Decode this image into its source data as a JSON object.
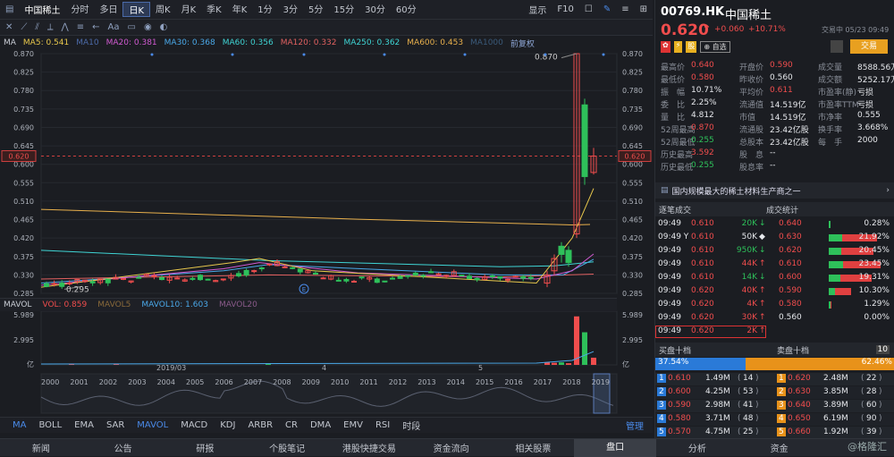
{
  "toolbar": {
    "name": "中国稀土",
    "periods": [
      "分时",
      "多日",
      "日K",
      "周K",
      "月K",
      "季K",
      "年K",
      "1分",
      "3分",
      "5分",
      "15分",
      "30分",
      "60分"
    ],
    "active": "日K",
    "display": "显示",
    "f10": "F10"
  },
  "ma_legend": [
    {
      "t": "MA",
      "c": "#c8ccd4"
    },
    {
      "t": "MA5: 0.541",
      "c": "#e8c84c"
    },
    {
      "t": "MA10",
      "c": "#4c6aa8"
    },
    {
      "t": "MA20: 0.381",
      "c": "#d05ad0"
    },
    {
      "t": "MA30: 0.368",
      "c": "#4aa8e8"
    },
    {
      "t": "MA60: 0.356",
      "c": "#3fd4d4"
    },
    {
      "t": "MA120: 0.332",
      "c": "#e06060"
    },
    {
      "t": "MA250: 0.362",
      "c": "#3fd4d4"
    },
    {
      "t": "MA600: 0.453",
      "c": "#e8b04c"
    },
    {
      "t": "MA1000",
      "c": "#3a5a7a"
    },
    {
      "t": "前复权",
      "c": "#8fa8d8"
    }
  ],
  "price_axis": [
    "0.870",
    "0.825",
    "0.780",
    "0.735",
    "0.690",
    "0.645",
    "0.600",
    "0.555",
    "0.510",
    "0.465",
    "0.420",
    "0.375",
    "0.330",
    "0.285"
  ],
  "price_marker": "0.620",
  "high_label": "0.870",
  "low_label": "0.295",
  "vol_legend": [
    {
      "t": "MAVOL",
      "c": "#c8ccd4"
    },
    {
      "t": "VOL: 0.859",
      "c": "#f04d4d"
    },
    {
      "t": "MAVOL5",
      "c": "#8a6a3a"
    },
    {
      "t": "MAVOL10: 1.603",
      "c": "#4aa8e8"
    },
    {
      "t": "MAVOL20",
      "c": "#8a5a8a"
    }
  ],
  "vol_axis": [
    "5.989",
    "2.995",
    "亿"
  ],
  "date_label": "2019/03",
  "markers": [
    "4",
    "5"
  ],
  "x_years": [
    "2000",
    "2001",
    "2002",
    "2003",
    "2004",
    "2005",
    "2006",
    "2007",
    "2008",
    "2009",
    "2010",
    "2011",
    "2012",
    "2013",
    "2014",
    "2015",
    "2016",
    "2017",
    "2018",
    "2019"
  ],
  "indicators": [
    "MA",
    "BOLL",
    "EMA",
    "SAR",
    "MAVOL",
    "MACD",
    "KDJ",
    "ARBR",
    "CR",
    "DMA",
    "EMV",
    "RSI",
    "时段"
  ],
  "manage": "管理",
  "bottom_tabs": [
    "新闻",
    "公告",
    "研报",
    "个股笔记",
    "港股快捷交易",
    "资金流向",
    "相关股票",
    "盘口",
    "分析",
    "资金"
  ],
  "watermark": "格隆汇",
  "stock": {
    "code": "00769.HK",
    "name": "中国稀土",
    "price": "0.620",
    "arrow": "↑",
    "change": "+0.060",
    "pct": "+10.71%",
    "status": "交易中 05/23 09:49",
    "self": "自选",
    "trade": "交易",
    "intro": "国内规模最大的稀土材料生产商之一"
  },
  "stats": [
    [
      [
        "最高价",
        "0.640",
        "up"
      ],
      [
        "开盘价",
        "0.590",
        "up"
      ],
      [
        "成交量",
        "8588.56万",
        "wh"
      ]
    ],
    [
      [
        "最低价",
        "0.580",
        "up"
      ],
      [
        "昨收价",
        "0.560",
        "wh"
      ],
      [
        "成交额",
        "5252.17万",
        "wh"
      ]
    ],
    [
      [
        "振　幅",
        "10.71%",
        "wh"
      ],
      [
        "平均价",
        "0.611",
        "up"
      ],
      [
        "市盈率(静)",
        "亏损",
        "wh"
      ]
    ],
    [
      [
        "委　比",
        "2.25%",
        "wh"
      ],
      [
        "流通值",
        "14.519亿",
        "wh"
      ],
      [
        "市盈率TTM",
        "亏损",
        "wh"
      ]
    ],
    [
      [
        "量　比",
        "4.812",
        "wh"
      ],
      [
        "市值",
        "14.519亿",
        "wh"
      ],
      [
        "市净率",
        "0.555",
        "wh"
      ]
    ],
    [
      [
        "52周最高",
        "0.870",
        "up"
      ],
      [
        "流通股",
        "23.42亿股",
        "wh"
      ],
      [
        "换手率",
        "3.668%",
        "wh"
      ]
    ],
    [
      [
        "52周最低",
        "0.255",
        "dn"
      ],
      [
        "总股本",
        "23.42亿股",
        "wh"
      ],
      [
        "每　手",
        "2000",
        "wh"
      ]
    ],
    [
      [
        "历史最高",
        "3.592",
        "up"
      ],
      [
        "股　息",
        "--",
        "wh"
      ],
      [
        "",
        "",
        ""
      ]
    ],
    [
      [
        "历史最低",
        "0.255",
        "dn"
      ],
      [
        "股息率",
        "--",
        "wh"
      ],
      [
        "",
        "",
        ""
      ]
    ]
  ],
  "ticks_title": "逐笔成交",
  "stat_title": "成交统计",
  "ticks": [
    [
      "09:49",
      "0.610",
      "20K",
      "↓",
      "dn"
    ],
    [
      "09:49 Y",
      "0.610",
      "50K",
      "◆",
      "wh"
    ],
    [
      "09:49",
      "0.610",
      "950K",
      "↓",
      "dn"
    ],
    [
      "09:49",
      "0.610",
      "44K",
      "↑",
      "up"
    ],
    [
      "09:49",
      "0.610",
      "14K",
      "↓",
      "dn"
    ],
    [
      "09:49",
      "0.620",
      "40K",
      "↑",
      "up"
    ],
    [
      "09:49",
      "0.620",
      "4K",
      "↑",
      "up"
    ],
    [
      "09:49",
      "0.620",
      "30K",
      "↑",
      "up"
    ],
    [
      "09:49",
      "0.620",
      "2K",
      "↑",
      "up"
    ]
  ],
  "dist": [
    [
      "0.640",
      "0.28%",
      1
    ],
    [
      "0.630",
      "21.92%",
      60
    ],
    [
      "0.620",
      "20.45%",
      56
    ],
    [
      "0.610",
      "23.45%",
      64
    ],
    [
      "0.600",
      "19.31%",
      53
    ],
    [
      "0.590",
      "10.30%",
      28
    ],
    [
      "0.580",
      "1.29%",
      3
    ],
    [
      "0.560",
      "0.00%",
      0
    ]
  ],
  "bid_title": "买盘十档",
  "ask_title": "卖盘十档",
  "ten": "10",
  "bid_pct": "37.54%",
  "ask_pct": "62.46%",
  "book": [
    [
      "1",
      "0.610",
      "1.49M",
      "14",
      "1",
      "0.620",
      "2.48M",
      "22"
    ],
    [
      "2",
      "0.600",
      "4.25M",
      "53",
      "2",
      "0.630",
      "3.85M",
      "28"
    ],
    [
      "3",
      "0.590",
      "2.98M",
      "41",
      "3",
      "0.640",
      "3.89M",
      "60"
    ],
    [
      "4",
      "0.580",
      "3.71M",
      "48",
      "4",
      "0.650",
      "6.19M",
      "90"
    ],
    [
      "5",
      "0.570",
      "4.75M",
      "25",
      "5",
      "0.660",
      "1.92M",
      "39"
    ]
  ],
  "chart_data": {
    "type": "candlestick",
    "title": "00769.HK 中国稀土 日K",
    "last": 0.62,
    "high": 0.87,
    "low": 0.295,
    "ylim": [
      0.285,
      0.87
    ],
    "vol_ylim": [
      0,
      5.989
    ],
    "vol_unit": "亿",
    "ma": {
      "MA5": 0.541,
      "MA20": 0.381,
      "MA30": 0.368,
      "MA60": 0.356,
      "MA120": 0.332,
      "MA250": 0.362,
      "MA600": 0.453
    }
  }
}
